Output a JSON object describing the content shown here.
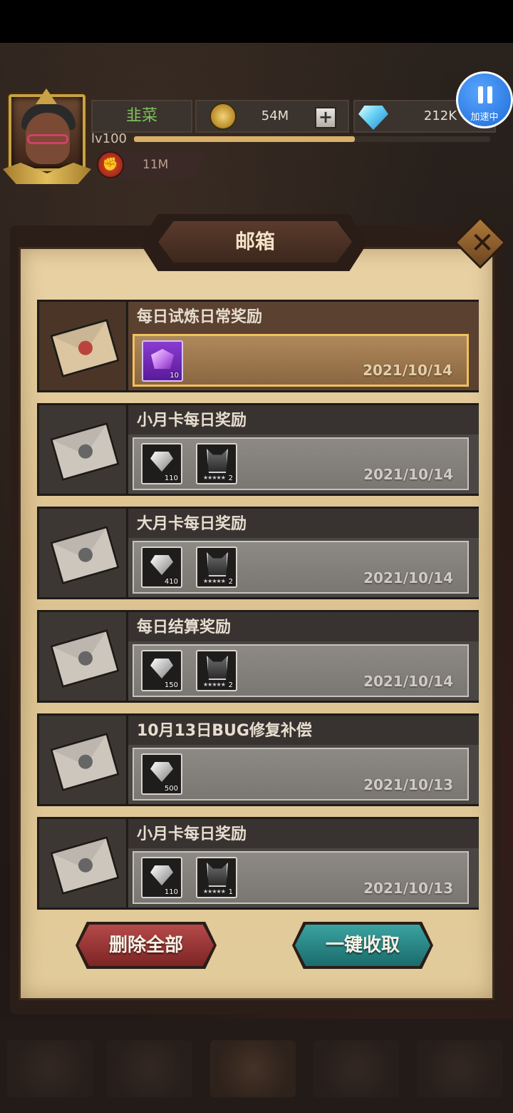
{
  "player": {
    "name": "韭菜",
    "level": "lv100",
    "xp_progress": 0.62,
    "power": "11M"
  },
  "resources": {
    "gold": "54M",
    "diamonds": "212K"
  },
  "speed": {
    "label": "加速中"
  },
  "mailbox": {
    "title": "邮箱",
    "mails": [
      {
        "title": "每日试炼日常奖励",
        "date": "2021/10/14",
        "status": "unread",
        "items": [
          {
            "type": "purple-crystal",
            "count": "10"
          }
        ]
      },
      {
        "title": "小月卡每日奖励",
        "date": "2021/10/14",
        "status": "read",
        "items": [
          {
            "type": "diamond",
            "count": "110"
          },
          {
            "type": "hero-token",
            "count": "2",
            "stars": "★★★★★"
          }
        ]
      },
      {
        "title": "大月卡每日奖励",
        "date": "2021/10/14",
        "status": "read",
        "items": [
          {
            "type": "diamond",
            "count": "410"
          },
          {
            "type": "hero-token",
            "count": "2",
            "stars": "★★★★★"
          }
        ]
      },
      {
        "title": "每日结算奖励",
        "date": "2021/10/14",
        "status": "read",
        "items": [
          {
            "type": "diamond",
            "count": "150"
          },
          {
            "type": "hero-token",
            "count": "2",
            "stars": "★★★★★"
          }
        ]
      },
      {
        "title": "10月13日BUG修复补偿",
        "date": "2021/10/13",
        "status": "read",
        "items": [
          {
            "type": "diamond",
            "count": "500"
          }
        ]
      },
      {
        "title": "小月卡每日奖励",
        "date": "2021/10/13",
        "status": "read",
        "items": [
          {
            "type": "diamond",
            "count": "110"
          },
          {
            "type": "hero-token",
            "count": "1",
            "stars": "★★★★★"
          }
        ]
      }
    ],
    "delete_all_label": "删除全部",
    "claim_all_label": "一键收取"
  },
  "icons": {
    "gold": "coin-icon",
    "diamonds": "diamond-icon",
    "power": "fist-icon",
    "close": "close-icon",
    "add": "plus-icon",
    "speed": "pause-icon"
  },
  "colors": {
    "player_name": "#7dc25b",
    "unread_highlight": "#f0c15e",
    "delete_button": "#b54a4a",
    "claim_button": "#3aa3a1"
  }
}
